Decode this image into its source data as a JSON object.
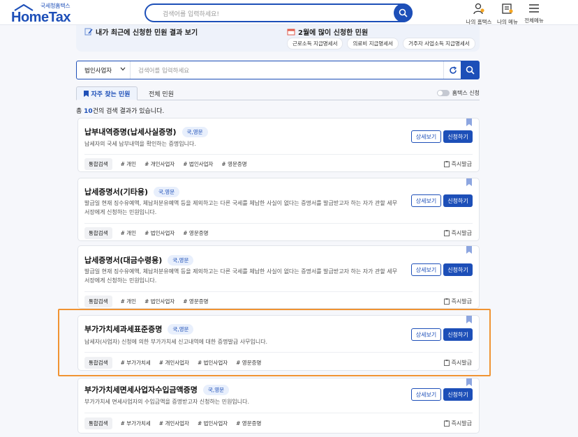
{
  "header": {
    "logo_small": "국세청홈택스",
    "logo_main": "HomeTax",
    "search_placeholder": "검색어를 입력하세요!",
    "icons": [
      {
        "label": "나의 홈택스",
        "icon": "person-bell-icon"
      },
      {
        "label": "나의 메뉴",
        "icon": "person-doc-icon"
      },
      {
        "label": "전체메뉴",
        "icon": "hamburger-menu-icon"
      }
    ]
  },
  "panel": {
    "left_title": "내가 최근에 신청한 민원 결과 보기",
    "right_title": "2월에 많이 신청한 민원",
    "chips": [
      "근로소득 지급명세서",
      "의료비 지급명세서",
      "거주자 사업소득 지급명세서"
    ]
  },
  "search": {
    "select_value": "법인사업자",
    "placeholder": "검색어를 입력하세요"
  },
  "tabs": {
    "active": "자주 찾는 민원",
    "other": "전체 민원",
    "toggle_label": "홈택스 신청"
  },
  "result": {
    "prefix": "총 ",
    "count": "10",
    "suffix": "건의 검색 결과가 있습니다."
  },
  "buttons": {
    "detail": "상세보기",
    "apply": "신청하기",
    "instant": "즉시발급"
  },
  "cards": [
    {
      "title": "납부내역증명(납세사실증명)",
      "badge": "국,영문",
      "desc": "납세자의 국세 납부내역을 확인하는 증명입니다.",
      "tag_main": "통합검색",
      "tags": [
        "# 개인",
        "# 개인사업자",
        "# 법인사업자",
        "# 영문증명"
      ]
    },
    {
      "title": "납세증명서(기타용)",
      "badge": "국,영문",
      "desc": "발급일 현재 징수유예액, 체납처분유예액 등을 제외하고는 다른 국세를 체납한 사실이 없다는 증명서를 발급받고자 하는 자가 관할 세무서장에게 신청하는 민원입니다.",
      "tag_main": "통합검색",
      "tags": [
        "# 개인",
        "# 법인사업자",
        "# 영문증명"
      ]
    },
    {
      "title": "납세증명서(대금수령용)",
      "badge": "국,영문",
      "desc": "발급일 현재 징수유예액, 체납처분유예액 등을 제외하고는 다른 국세를 체납한 사실이 없다는 증명서를 발급받고자 하는 자가 관할 세무서장에게 신청하는 민원입니다.",
      "tag_main": "통합검색",
      "tags": [
        "# 개인",
        "# 법인사업자",
        "# 영문증명"
      ]
    },
    {
      "title": "부가가치세과세표준증명",
      "badge": "국,영문",
      "desc": "납세자(사업자) 신청에 의한 부가가치세 신고내역에 대한 증명발급 사무입니다.",
      "tag_main": "통합검색",
      "tags": [
        "# 부가가치세",
        "# 개인사업자",
        "# 법인사업자",
        "# 영문증명"
      ]
    },
    {
      "title": "부가가치세면세사업자수입금액증명",
      "badge": "국,영문",
      "desc": "부가가치세 면세사업자의 수입금액을 증명받고자 신청하는 민원입니다.",
      "tag_main": "통합검색",
      "tags": [
        "# 부가가치세",
        "# 개인사업자",
        "# 법인사업자",
        "# 영문증명"
      ]
    }
  ]
}
